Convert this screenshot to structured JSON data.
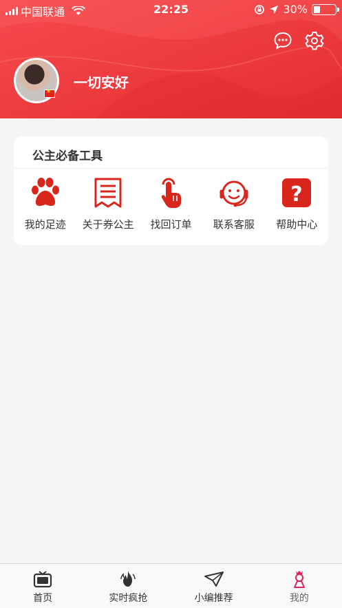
{
  "status_bar": {
    "carrier": "中国联通",
    "time": "22:25",
    "battery": "30%",
    "battery_level": 0.3,
    "icons": [
      "signal-icon",
      "wifi-icon",
      "orientation-lock-icon",
      "location-icon",
      "battery-icon"
    ]
  },
  "header": {
    "username": "一切安好",
    "actions": [
      "message-icon",
      "settings-icon"
    ],
    "colors": {
      "primary": "#ec3a3d",
      "white": "#ffffff"
    }
  },
  "tools_card": {
    "title": "公主必备工具",
    "items": [
      {
        "label": "我的足迹",
        "icon": "paw-icon"
      },
      {
        "label": "关于券公主",
        "icon": "document-icon"
      },
      {
        "label": "找回订单",
        "icon": "tap-hand-icon"
      },
      {
        "label": "联系客服",
        "icon": "headset-icon"
      },
      {
        "label": "帮助中心",
        "icon": "help-icon"
      }
    ],
    "icon_color": "#d9261c"
  },
  "tab_bar": {
    "items": [
      {
        "label": "首页",
        "icon": "tv-home-icon"
      },
      {
        "label": "实时疯抢",
        "icon": "flame-icon"
      },
      {
        "label": "小编推荐",
        "icon": "paper-plane-icon"
      },
      {
        "label": "我的",
        "icon": "princess-icon",
        "active": true
      }
    ],
    "active_color": "#e0245a"
  }
}
